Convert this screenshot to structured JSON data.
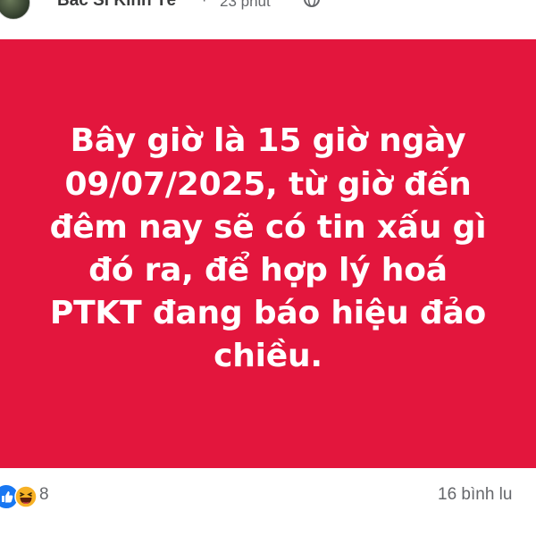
{
  "post": {
    "author": "Bác Sĩ Kinh Tế",
    "separator": "·",
    "time": "23 phút",
    "privacy_icon": "globe-icon",
    "card_color": "#e3163d",
    "card_text_lines": [
      "Bây giờ là 15 giờ ngày",
      "09/07/2025, từ giờ đến",
      "đêm nay sẽ có tin xấu gì",
      "đó ra, để hợp lý hoá",
      "PTKT đang báo hiệu đảo",
      "chiều."
    ]
  },
  "footer": {
    "reaction_icons": [
      "like-icon",
      "haha-icon"
    ],
    "reaction_count": "8",
    "comment_count": "16 bình lu"
  }
}
